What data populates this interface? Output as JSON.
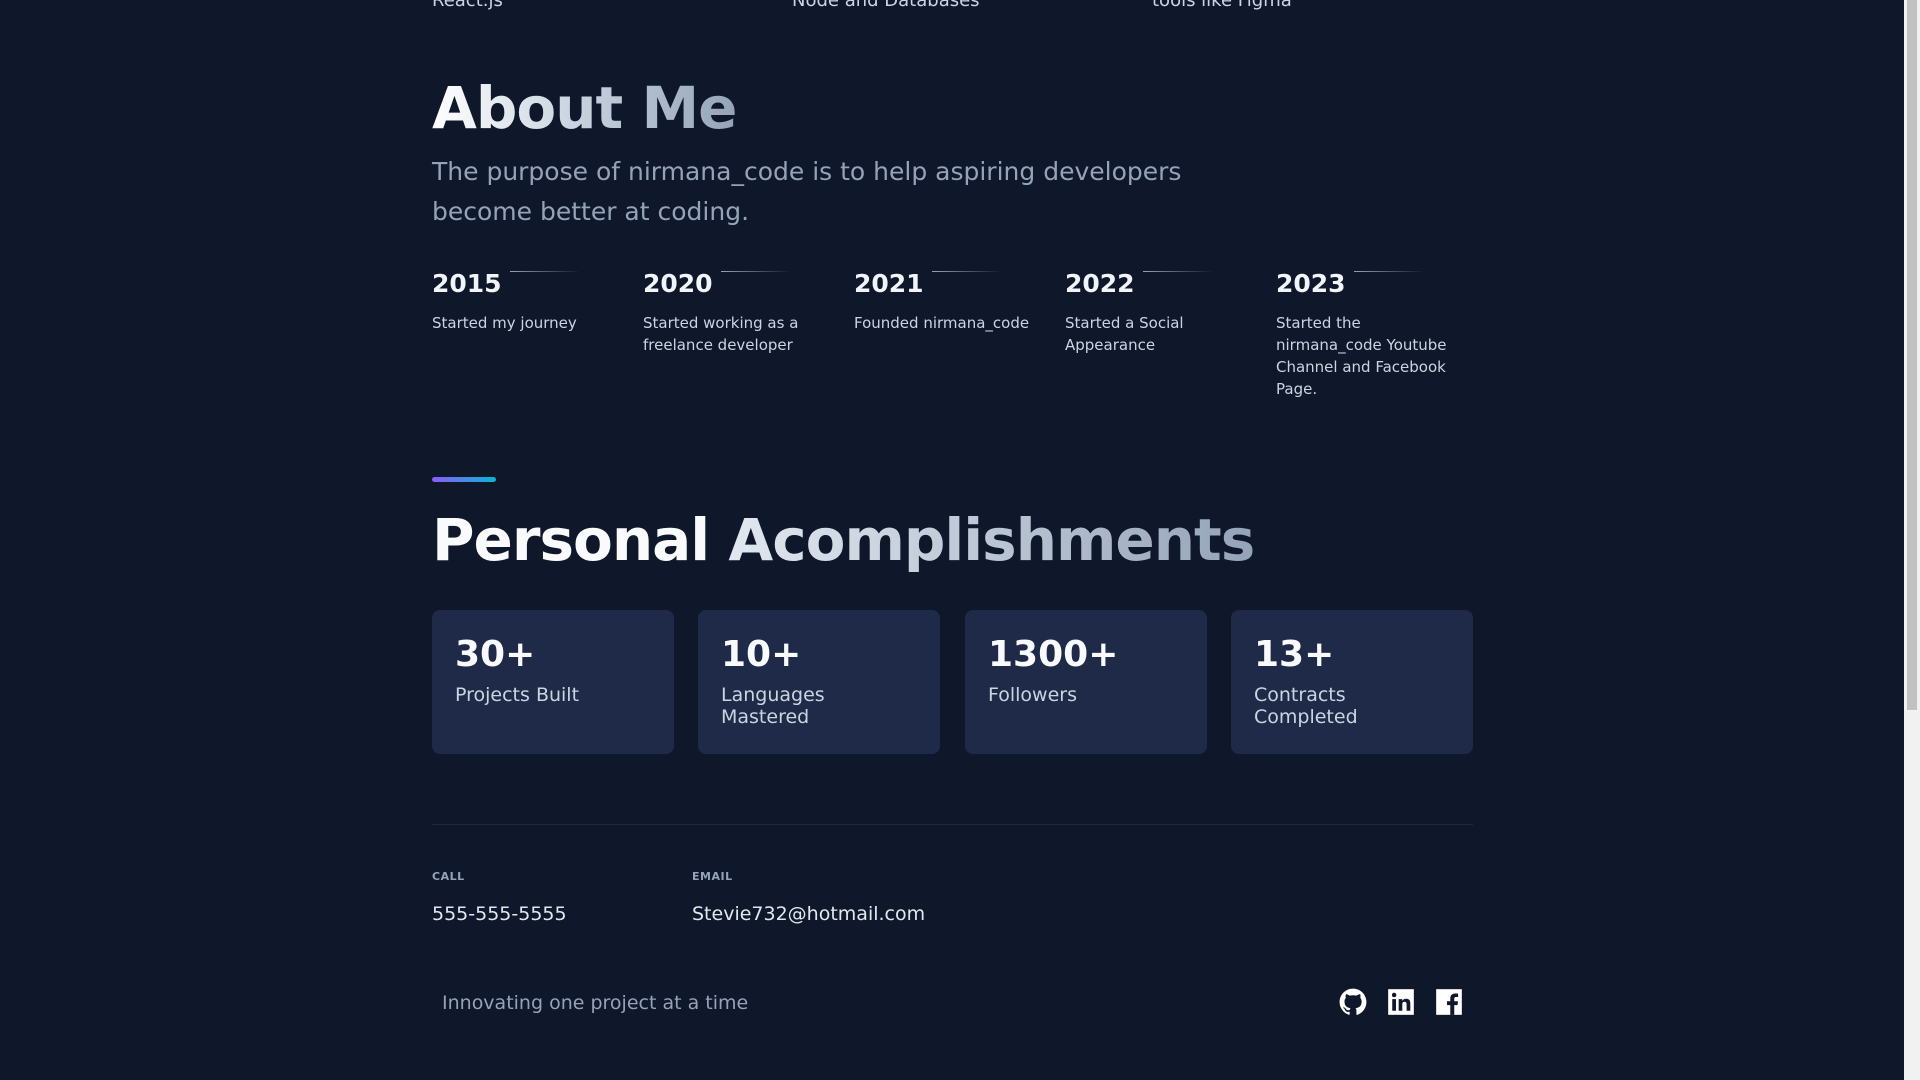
{
  "previous_section": {
    "items": [
      "React.js",
      "Node and Databases",
      "tools like Figma"
    ]
  },
  "about": {
    "title": "About Me",
    "description": "The purpose of nirmana_code is to help aspiring developers become better at coding."
  },
  "timeline": [
    {
      "year": "2015",
      "text": "Started my journey"
    },
    {
      "year": "2020",
      "text": "Started working as a freelance developer"
    },
    {
      "year": "2021",
      "text": "Founded nirmana_code"
    },
    {
      "year": "2022",
      "text": "Started a Social Appearance"
    },
    {
      "year": "2023",
      "text": "Started the nirmana_code Youtube Channel and Facebook Page."
    }
  ],
  "accomplishments": {
    "title_part1": "Personal",
    "title_part2": "Acomplishments",
    "stats": [
      {
        "number": "30+",
        "label": "Projects Built"
      },
      {
        "number": "10+",
        "label": "Languages Mastered"
      },
      {
        "number": "1300+",
        "label": "Followers"
      },
      {
        "number": "13+",
        "label": "Contracts Completed"
      }
    ]
  },
  "contact": {
    "call_label": "CALL",
    "phone": "555-555-5555",
    "email_label": "EMAIL",
    "email": "Stevie732@hotmail.com"
  },
  "footer": {
    "tagline": "Innovating one project at a time",
    "socials": [
      "github-icon",
      "linkedin-icon",
      "facebook-icon"
    ]
  },
  "colors": {
    "background": "#0f172a",
    "card": "#1e2a47",
    "accent_start": "#8b5cf6",
    "accent_end": "#06b6d4"
  }
}
